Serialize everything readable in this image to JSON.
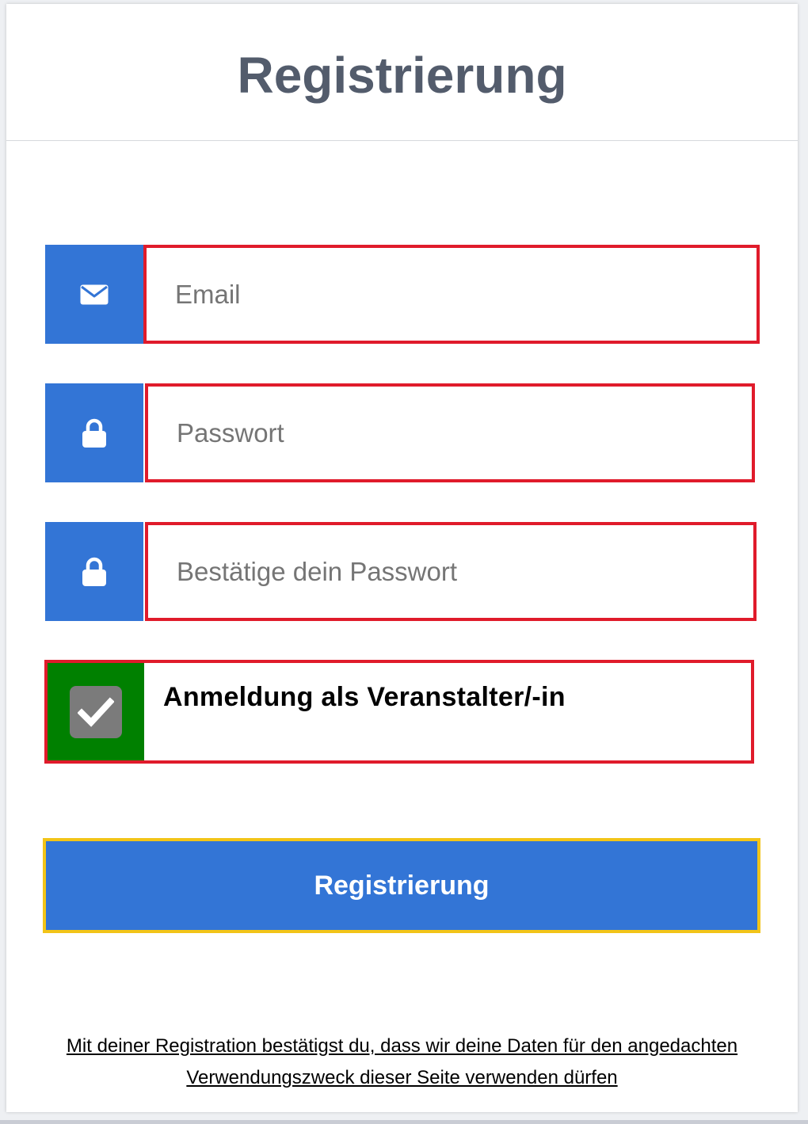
{
  "header": {
    "title": "Registrierung"
  },
  "form": {
    "email": {
      "placeholder": "Email",
      "value": "",
      "icon": "envelope-icon"
    },
    "password": {
      "placeholder": "Passwort",
      "value": "",
      "icon": "lock-icon"
    },
    "confirm_password": {
      "placeholder": "Bestätige dein Passwort",
      "value": "",
      "icon": "lock-icon"
    },
    "organizer_checkbox": {
      "label": "Anmeldung als Veranstalter/-in",
      "checked": true
    },
    "submit_label": "Registrierung"
  },
  "footer": {
    "disclaimer_line1": "Mit deiner Registration bestätigst du, dass wir deine Daten für den angedachten",
    "disclaimer_line2": "Verwendungszweck dieser Seite verwenden dürfen"
  },
  "colors": {
    "accent": "#3375d6",
    "error_border": "#e01b2b",
    "checkbox_bg": "#008000",
    "focus_border": "#f2c418",
    "title": "#535c6c"
  }
}
